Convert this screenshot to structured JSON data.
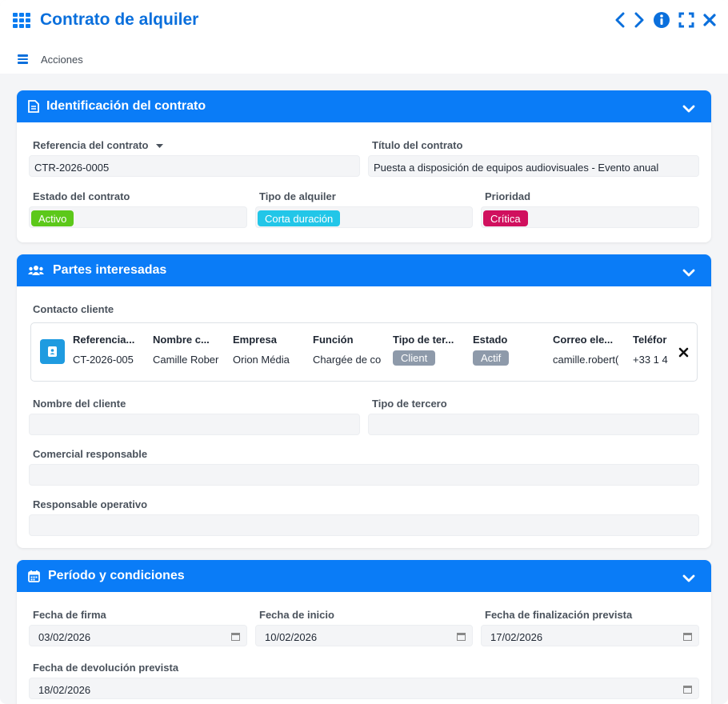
{
  "window": {
    "title": "Contrato de alquiler"
  },
  "toolbar": {
    "actions_label": "Acciones"
  },
  "identification": {
    "title": "Identificación del contrato",
    "reference_label": "Referencia del contrato",
    "reference_value": "CTR-2026-0005",
    "contract_title_label": "Título del contrato",
    "contract_title_value": "Puesta a disposición de equipos audiovisuales - Evento anual",
    "status_label": "Estado del contrato",
    "status_value": "Activo",
    "rental_type_label": "Tipo de alquiler",
    "rental_type_value": "Corta duración",
    "priority_label": "Prioridad",
    "priority_value": "Crítica"
  },
  "parties": {
    "title": "Partes interesadas",
    "contact_label": "Contacto cliente",
    "contact": {
      "columns": [
        "Referencia...",
        "Nombre c...",
        "Empresa",
        "Función",
        "Tipo de ter...",
        "Estado",
        "Correo ele...",
        "Teléfor"
      ],
      "reference": "CT-2026-005",
      "name": "Camille Rober",
      "company": "Orion Média",
      "function": "Chargée de co",
      "third_party_type": "Client",
      "status": "Actif",
      "email": "camille.robert(",
      "phone": "+33 1 4"
    },
    "client_name_label": "Nombre del cliente",
    "client_name_value": "",
    "third_type_label": "Tipo de tercero",
    "third_type_value": "",
    "sales_label": "Comercial responsable",
    "sales_value": "",
    "operations_label": "Responsable operativo",
    "operations_value": ""
  },
  "period": {
    "title": "Período y condiciones",
    "signature_label": "Fecha de firma",
    "signature_value": "03/02/2026",
    "start_label": "Fecha de inicio",
    "start_value": "10/02/2026",
    "end_label": "Fecha de finalización prevista",
    "end_value": "17/02/2026",
    "return_label": "Fecha de devolución prevista",
    "return_value": "18/02/2026"
  },
  "colors": {
    "accent": "#0a7cf7",
    "status_active": "#5cc81a",
    "type_short": "#22c6e8",
    "priority_critical": "#d0105e",
    "badge_grey": "#8e9aaa"
  },
  "icons": [
    "app-grid-icon",
    "chevron-left-icon",
    "chevron-right-icon",
    "info-icon",
    "fullscreen-icon",
    "close-icon",
    "menu-icon",
    "document-icon",
    "users-icon",
    "calendar-icon",
    "chevron-down-icon",
    "contact-card-icon"
  ]
}
